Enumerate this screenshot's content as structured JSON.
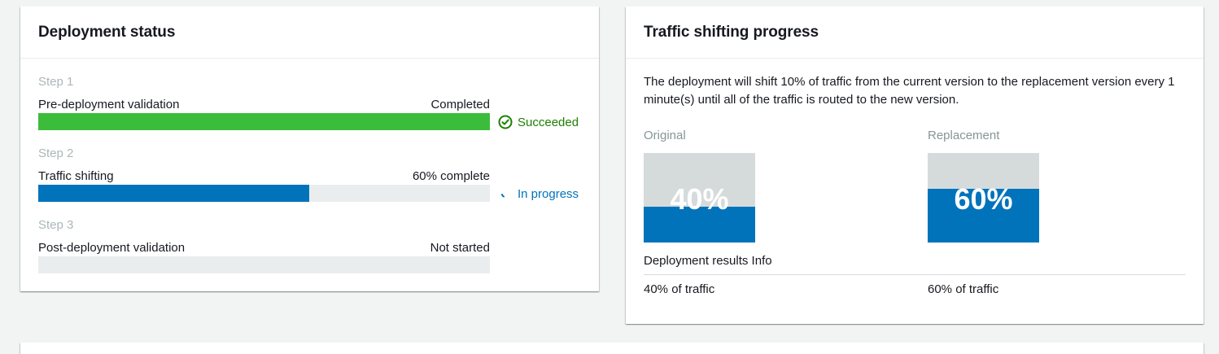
{
  "deployment_status": {
    "title": "Deployment status",
    "steps": [
      {
        "step_label": "Step 1",
        "name": "Pre-deployment validation",
        "state": "Completed",
        "progress_percent": 100,
        "status_label": "Succeeded",
        "status_icon": "check-circle-icon",
        "bar_color": "#3bbd3b",
        "status_color": "#1d8102"
      },
      {
        "step_label": "Step 2",
        "name": "Traffic shifting",
        "state": "60% complete",
        "progress_percent": 60,
        "status_label": "In progress",
        "status_icon": "spinner-icon",
        "bar_color": "#0073bb",
        "status_color": "#0073bb"
      },
      {
        "step_label": "Step 3",
        "name": "Post-deployment validation",
        "state": "Not started",
        "progress_percent": 0,
        "status_label": "",
        "status_icon": "",
        "bar_color": "#eaeded",
        "status_color": ""
      }
    ]
  },
  "traffic_shifting": {
    "title": "Traffic shifting progress",
    "description": "The deployment will shift 10% of traffic from the current version to the replacement version every 1 minute(s) until all of the traffic is routed to the new version.",
    "original": {
      "label": "Original",
      "percent_label": "40%",
      "percent": 40,
      "traffic_label": "40% of traffic"
    },
    "replacement": {
      "label": "Replacement",
      "percent_label": "60%",
      "percent": 60,
      "traffic_label": "60% of traffic"
    },
    "results_title": "Deployment results Info",
    "colors": {
      "fill": "#0073bb",
      "empty": "#d5dbdb"
    }
  }
}
